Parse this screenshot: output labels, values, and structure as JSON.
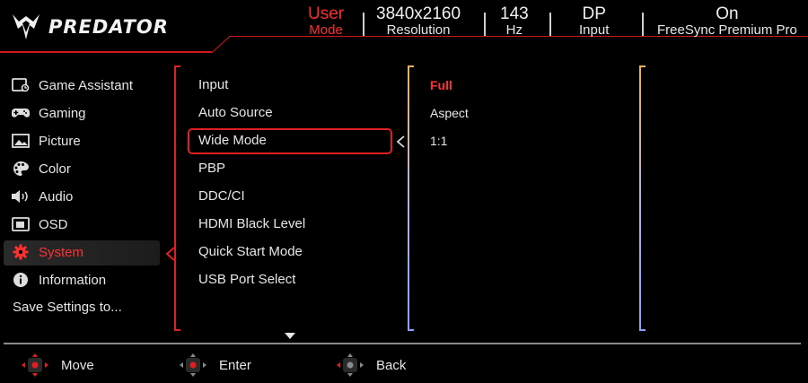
{
  "brand": {
    "logo_text": "PREDATOR",
    "accent_color": "#ff2d2d"
  },
  "status_bar": {
    "mode": {
      "value": "User",
      "label": "Mode"
    },
    "resolution": {
      "value": "3840x2160",
      "label": "Resolution"
    },
    "refresh": {
      "value": "143",
      "label": "Hz"
    },
    "input": {
      "value": "DP",
      "label": "Input"
    },
    "freesync": {
      "value": "On",
      "label": "FreeSync Premium Pro"
    }
  },
  "main_menu": [
    {
      "label": "Game Assistant",
      "icon": "game-assistant-icon"
    },
    {
      "label": "Gaming",
      "icon": "gamepad-icon"
    },
    {
      "label": "Picture",
      "icon": "picture-icon"
    },
    {
      "label": "Color",
      "icon": "palette-icon"
    },
    {
      "label": "Audio",
      "icon": "speaker-icon"
    },
    {
      "label": "OSD",
      "icon": "osd-icon"
    },
    {
      "label": "System",
      "icon": "gear-icon",
      "active": true
    },
    {
      "label": "Information",
      "icon": "info-icon"
    },
    {
      "label": "Save Settings to...",
      "icon": ""
    }
  ],
  "submenu": [
    "Input",
    "Auto Source",
    "Wide Mode",
    "PBP",
    "DDC/CI",
    "HDMI Black Level",
    "Quick Start Mode",
    "USB Port Select"
  ],
  "submenu_selected": "Wide Mode",
  "options": [
    {
      "label": "Full",
      "selected": true
    },
    {
      "label": "Aspect",
      "selected": false
    },
    {
      "label": "1:1",
      "selected": false
    }
  ],
  "footer": {
    "move": "Move",
    "enter": "Enter",
    "back": "Back"
  }
}
